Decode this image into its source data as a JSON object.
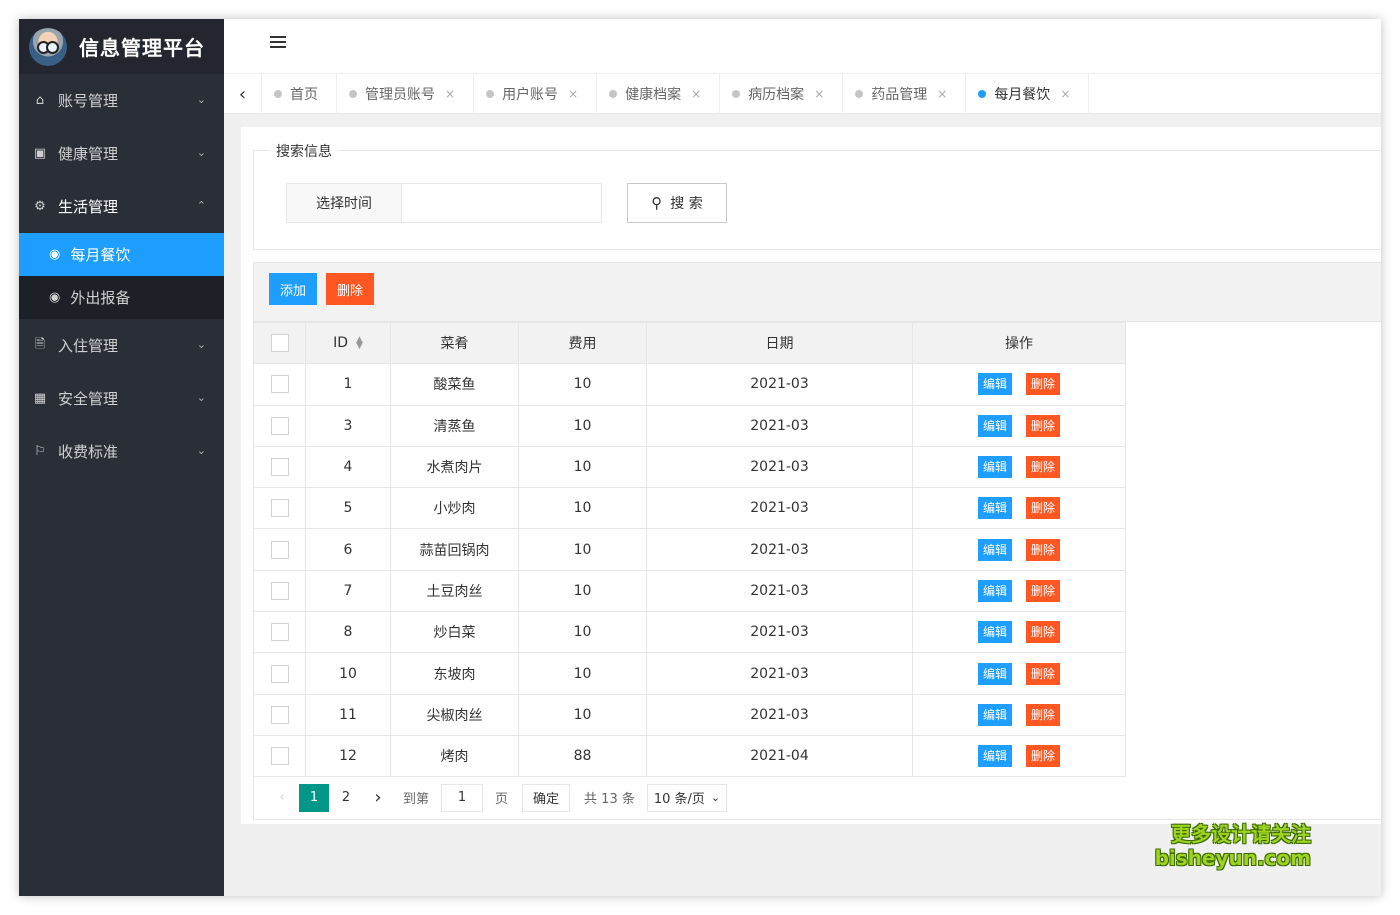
{
  "app": {
    "title": "信息管理平台"
  },
  "sidebar": {
    "items": [
      {
        "label": "账号管理",
        "icon": "home-icon"
      },
      {
        "label": "健康管理",
        "icon": "window-icon"
      },
      {
        "label": "生活管理",
        "icon": "gears-icon",
        "open": true,
        "children": [
          {
            "label": "每月餐饮",
            "icon": "dashboard-icon",
            "active": true
          },
          {
            "label": "外出报备",
            "icon": "dashboard-icon"
          }
        ]
      },
      {
        "label": "入住管理",
        "icon": "file-icon"
      },
      {
        "label": "安全管理",
        "icon": "calendar-icon"
      },
      {
        "label": "收费标准",
        "icon": "flag-icon"
      }
    ]
  },
  "tabs": [
    {
      "label": "首页",
      "closable": false
    },
    {
      "label": "管理员账号",
      "closable": true
    },
    {
      "label": "用户账号",
      "closable": true
    },
    {
      "label": "健康档案",
      "closable": true
    },
    {
      "label": "病历档案",
      "closable": true
    },
    {
      "label": "药品管理",
      "closable": true
    },
    {
      "label": "每月餐饮",
      "closable": true,
      "active": true
    }
  ],
  "search": {
    "legend": "搜索信息",
    "label": "选择时间",
    "value": "",
    "button": "搜 索"
  },
  "toolbar": {
    "add": "添加",
    "delete": "删除"
  },
  "table": {
    "headers": [
      "ID",
      "菜肴",
      "费用",
      "日期",
      "操作"
    ],
    "edit_label": "编辑",
    "delete_label": "删除",
    "rows": [
      {
        "id": "1",
        "dish": "酸菜鱼",
        "fee": "10",
        "date": "2021-03"
      },
      {
        "id": "3",
        "dish": "清蒸鱼",
        "fee": "10",
        "date": "2021-03"
      },
      {
        "id": "4",
        "dish": "水煮肉片",
        "fee": "10",
        "date": "2021-03"
      },
      {
        "id": "5",
        "dish": "小炒肉",
        "fee": "10",
        "date": "2021-03"
      },
      {
        "id": "6",
        "dish": "蒜苗回锅肉",
        "fee": "10",
        "date": "2021-03"
      },
      {
        "id": "7",
        "dish": "土豆肉丝",
        "fee": "10",
        "date": "2021-03"
      },
      {
        "id": "8",
        "dish": "炒白菜",
        "fee": "10",
        "date": "2021-03"
      },
      {
        "id": "10",
        "dish": "东坡肉",
        "fee": "10",
        "date": "2021-03"
      },
      {
        "id": "11",
        "dish": "尖椒肉丝",
        "fee": "10",
        "date": "2021-03"
      },
      {
        "id": "12",
        "dish": "烤肉",
        "fee": "88",
        "date": "2021-04"
      }
    ]
  },
  "pager": {
    "pages": [
      "1",
      "2"
    ],
    "current": "1",
    "goto_label": "到第",
    "goto_value": "1",
    "page_unit": "页",
    "confirm": "确定",
    "total": "共 13 条",
    "page_size": "10 条/页"
  },
  "watermark": {
    "line1": "更多设计请关注",
    "line2": "bisheyun.com"
  },
  "colors": {
    "primary": "#1e9fff",
    "danger": "#ff5722",
    "pager_current": "#009688",
    "sidebar_bg": "#2a2f37"
  }
}
